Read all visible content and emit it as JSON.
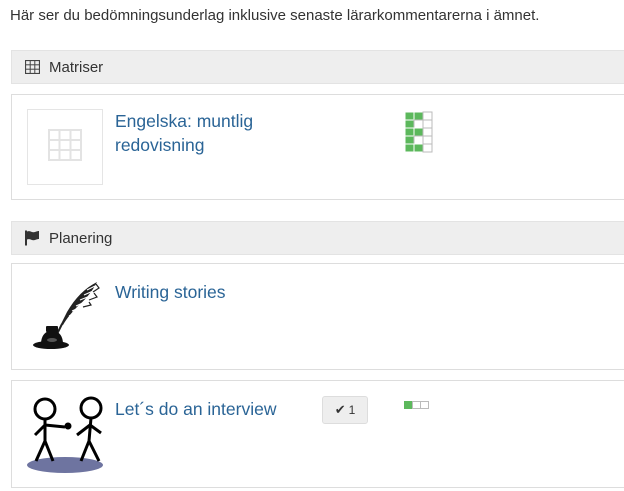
{
  "intro_text": "Här ser du bedömningsunderlag inklusive senaste lärarkommentarerna i ämnet.",
  "sections": [
    {
      "title": "Matriser",
      "icon": "table-icon",
      "items": [
        {
          "title_line1": "Engelska: muntlig",
          "title_line2": "redovisning",
          "thumbnail_icon": "table-icon",
          "matrix_progress": {
            "columns": 3,
            "rows": 5,
            "filled_per_row": [
              2,
              1,
              2,
              1,
              2
            ]
          }
        }
      ]
    },
    {
      "title": "Planering",
      "icon": "flag-icon",
      "items": [
        {
          "title": "Writing stories",
          "thumbnail_icon": "quill-inkwell-icon"
        },
        {
          "title": "Let´s do an interview",
          "thumbnail_icon": "interview-stick-figures-icon",
          "badge_count": "1",
          "badge_icon": "check-icon",
          "progress": {
            "segments": 3,
            "filled": 1
          }
        }
      ]
    }
  ],
  "colors": {
    "link": "#2a6496",
    "header_bg": "#eeeeee",
    "progress_fill": "#5cb85c"
  }
}
